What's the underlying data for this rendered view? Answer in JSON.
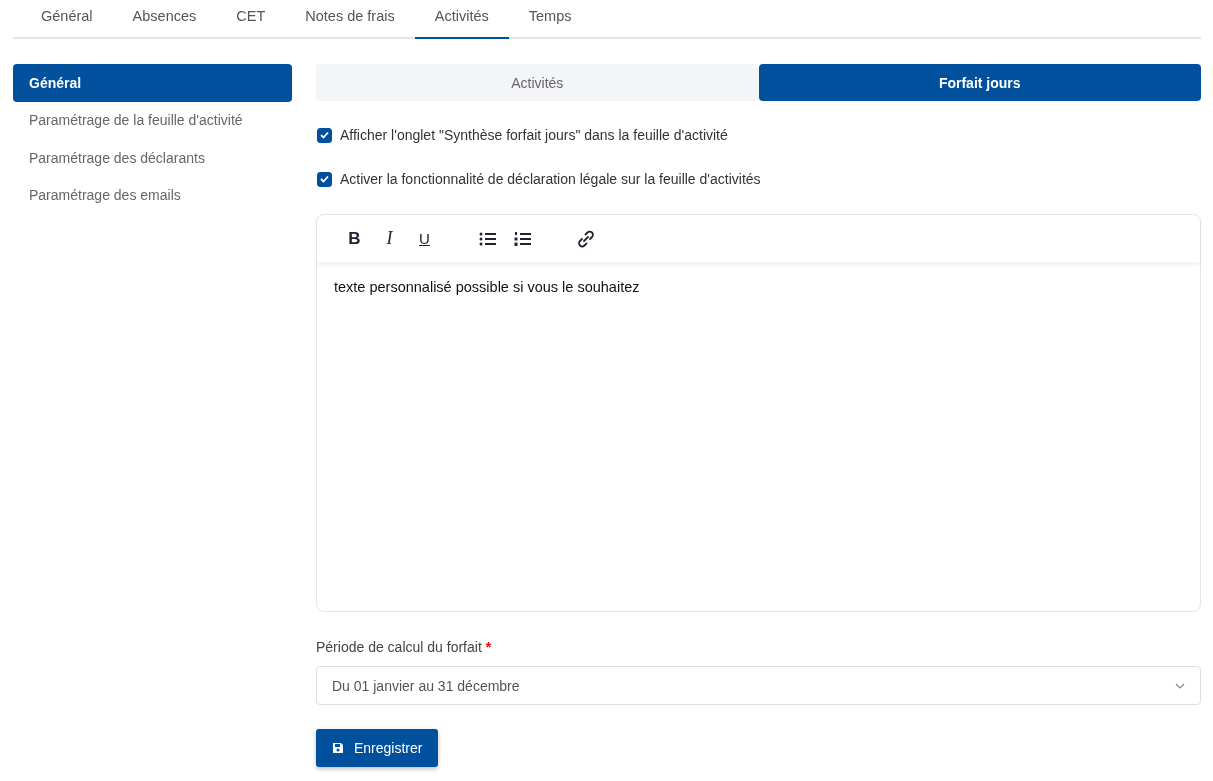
{
  "tabs": [
    {
      "label": "Général",
      "selected": false
    },
    {
      "label": "Absences",
      "selected": false
    },
    {
      "label": "CET",
      "selected": false
    },
    {
      "label": "Notes de frais",
      "selected": false
    },
    {
      "label": "Activités",
      "selected": true
    },
    {
      "label": "Temps",
      "selected": false
    }
  ],
  "sidebar": {
    "items": [
      {
        "label": "Général",
        "selected": true
      },
      {
        "label": "Paramétrage de la feuille d'activité",
        "selected": false
      },
      {
        "label": "Paramétrage des déclarants",
        "selected": false
      },
      {
        "label": "Paramétrage des emails",
        "selected": false
      }
    ]
  },
  "subtabs": [
    {
      "label": "Activités",
      "selected": false
    },
    {
      "label": "Forfait jours",
      "selected": true
    }
  ],
  "options": [
    {
      "label": "Afficher l'onglet \"Synthèse forfait jours\" dans la feuille d'activité",
      "checked": true
    },
    {
      "label": "Activer la fonctionnalité de déclaration légale sur la feuille d'activités",
      "checked": true
    }
  ],
  "editor": {
    "toolbar": [
      {
        "kind": "bold",
        "label": "B"
      },
      {
        "kind": "italic",
        "label": "I"
      },
      {
        "kind": "underline",
        "label": "U"
      },
      {
        "kind": "bullets"
      },
      {
        "kind": "numbers"
      },
      {
        "kind": "link"
      }
    ],
    "content": "texte personnalisé possible si vous le souhaitez"
  },
  "period": {
    "label": "Période de calcul du forfait",
    "required_mark": "*",
    "value": "Du 01 janvier au 31 décembre"
  },
  "save_button": {
    "label": "Enregistrer"
  }
}
